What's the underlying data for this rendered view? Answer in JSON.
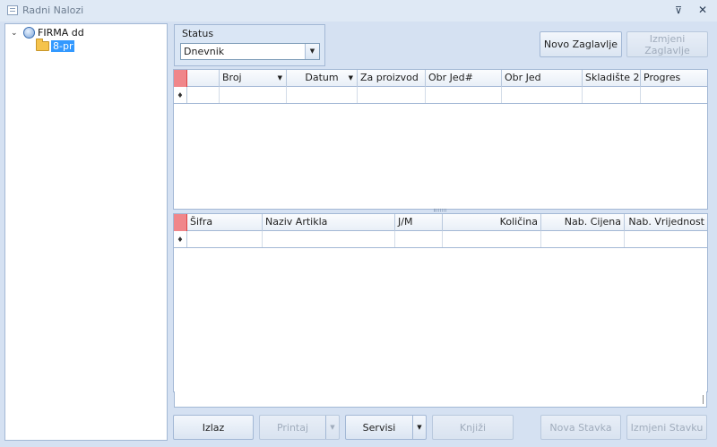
{
  "window": {
    "title": "Radni Nalozi",
    "pin_glyph": "⊽",
    "close_glyph": "✕"
  },
  "tree": {
    "root": {
      "label": "FIRMA dd",
      "icon": "firm-icon",
      "expander": "⌄"
    },
    "child": {
      "label": "8-pr",
      "icon": "folder-open-icon",
      "selected": true
    }
  },
  "status": {
    "label": "Status",
    "value": "Dnevnik"
  },
  "top_buttons": {
    "novo_zaglavlje": "Novo Zaglavlje",
    "izmjeni_zaglavlje": "Izmjeni Zaglavlje"
  },
  "header_grid": {
    "columns": [
      "Broj",
      "Datum",
      "Za proizvod",
      "Obr Jed#",
      "Obr Jed",
      "Skladište 2",
      "Progres"
    ]
  },
  "items_grid": {
    "columns": [
      "Šifra",
      "Naziv Artikla",
      "J/M",
      "Količina",
      "Nab. Cijena",
      "Nab. Vrijednost"
    ]
  },
  "bottom_buttons": {
    "izlaz": "Izlaz",
    "printaj": "Printaj",
    "servisi": "Servisi",
    "knjizi": "Knjiži",
    "nova_stavka": "Nova Stavka",
    "izmjeni_stavku": "Izmjeni Stavku"
  },
  "colors": {
    "accent_selected": "#3399ff",
    "indicator": "#f0868a",
    "panel_bg": "#d5e1f2"
  }
}
